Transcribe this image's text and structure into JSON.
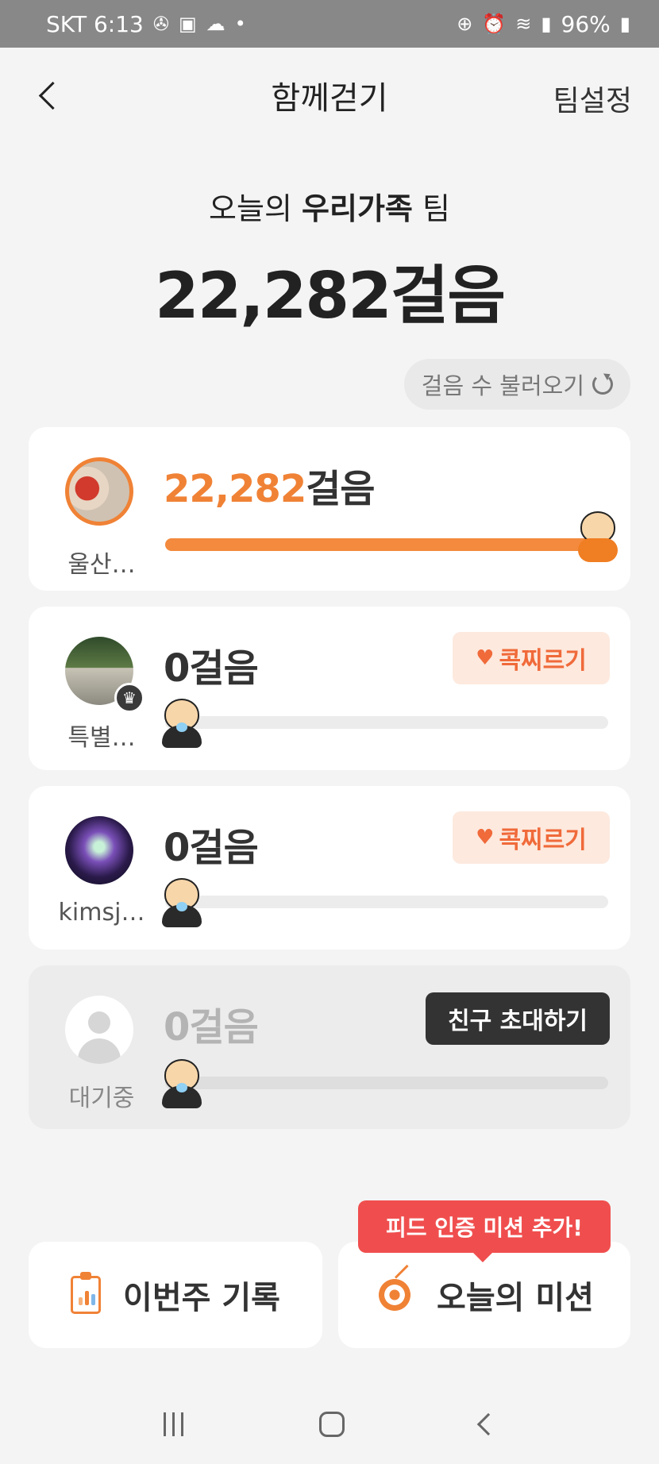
{
  "status_bar": {
    "carrier_time": "SKT 6:13",
    "left_icons": [
      "fan-icon",
      "image-icon",
      "cloud-icon",
      "dot-icon"
    ],
    "right_icons": [
      "lock-icon",
      "alarm-icon",
      "wifi-icon",
      "signal-icon"
    ],
    "battery": "96%"
  },
  "header": {
    "title": "함께걷기",
    "team_settings": "팀설정"
  },
  "summary": {
    "prefix": "오늘의",
    "team_name": "우리가족",
    "suffix": "팀",
    "total_steps": "22,282걸음",
    "refresh_label": "걸음 수 불러오기"
  },
  "members": [
    {
      "name": "울산…",
      "steps_number": "22,282",
      "steps_unit": "걸음",
      "progress": 1.0,
      "action": null
    },
    {
      "name": "특별…",
      "steps_number": "0",
      "steps_unit": "걸음",
      "progress": 0,
      "action": "콕찌르기",
      "leader": true
    },
    {
      "name": "kimsj…",
      "steps_number": "0",
      "steps_unit": "걸음",
      "progress": 0,
      "action": "콕찌르기"
    },
    {
      "name": "대기중",
      "steps_number": "0",
      "steps_unit": "걸음",
      "progress": 0,
      "action": "친구 초대하기",
      "pending": true
    }
  ],
  "bottom": {
    "tooltip": "피드 인증 미션 추가!",
    "week_record": "이번주 기록",
    "today_mission": "오늘의 미션"
  },
  "colors": {
    "accent": "#f08236",
    "poke_bg": "#fde9de",
    "tooltip_bg": "#f04e4e",
    "status_bar_bg": "#888888"
  }
}
